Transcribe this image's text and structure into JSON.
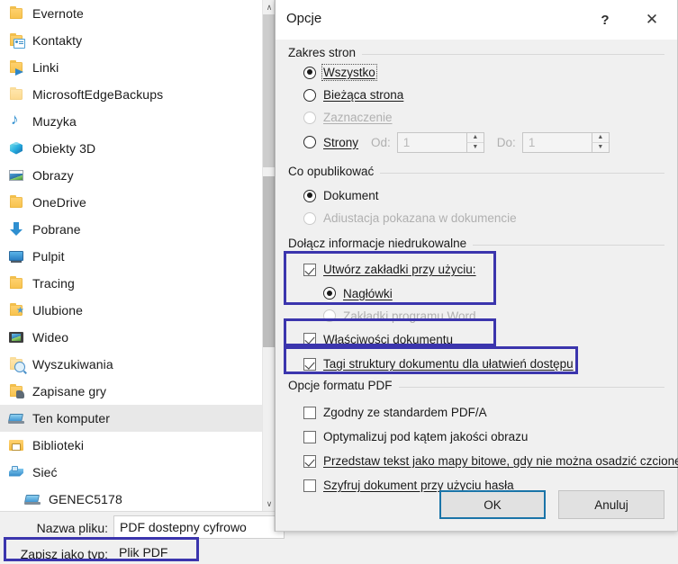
{
  "file_tree": {
    "items": [
      {
        "label": "Evernote",
        "icon": "folder-icon",
        "indent": 1,
        "selected": false
      },
      {
        "label": "Kontakty",
        "icon": "contacts-folder-icon",
        "indent": 1,
        "selected": false
      },
      {
        "label": "Linki",
        "icon": "links-folder-icon",
        "indent": 1,
        "selected": false
      },
      {
        "label": "MicrosoftEdgeBackups",
        "icon": "folder-icon",
        "indent": 1,
        "selected": false
      },
      {
        "label": "Muzyka",
        "icon": "music-note-icon",
        "indent": 1,
        "selected": false
      },
      {
        "label": "Obiekty 3D",
        "icon": "3d-objects-icon",
        "indent": 1,
        "selected": false
      },
      {
        "label": "Obrazy",
        "icon": "pictures-icon",
        "indent": 1,
        "selected": false
      },
      {
        "label": "OneDrive",
        "icon": "folder-icon",
        "indent": 1,
        "selected": false
      },
      {
        "label": "Pobrane",
        "icon": "downloads-arrow-icon",
        "indent": 1,
        "selected": false
      },
      {
        "label": "Pulpit",
        "icon": "desktop-icon",
        "indent": 1,
        "selected": false
      },
      {
        "label": "Tracing",
        "icon": "folder-icon",
        "indent": 1,
        "selected": false
      },
      {
        "label": "Ulubione",
        "icon": "favorites-folder-icon",
        "indent": 1,
        "selected": false
      },
      {
        "label": "Wideo",
        "icon": "video-icon",
        "indent": 1,
        "selected": false
      },
      {
        "label": "Wyszukiwania",
        "icon": "search-folder-icon",
        "indent": 1,
        "selected": false
      },
      {
        "label": "Zapisane gry",
        "icon": "saved-games-folder-icon",
        "indent": 1,
        "selected": false
      },
      {
        "label": "Ten komputer",
        "icon": "this-pc-icon",
        "indent": 1,
        "selected": true
      },
      {
        "label": "Biblioteki",
        "icon": "libraries-icon",
        "indent": 1,
        "selected": false
      },
      {
        "label": "Sieć",
        "icon": "network-icon",
        "indent": 1,
        "selected": false
      },
      {
        "label": "GENEC5178",
        "icon": "computer-icon",
        "indent": 2,
        "selected": false
      }
    ],
    "scrollbar": {
      "up_arrow": "∧",
      "down_arrow": "∨"
    }
  },
  "bottom_bar": {
    "file_name_label": "Nazwa pliku:",
    "file_name_value": "PDF dostepny cyfrowo",
    "save_as_type_label": "Zapisz jako typ:",
    "save_as_type_value": "Plik PDF",
    "highlight_color": "#3b35ad"
  },
  "dialog": {
    "title": "Opcje",
    "help_icon": "?",
    "close_icon": "✕",
    "highlight_color": "#3b35ad",
    "groups": {
      "page_range": {
        "label": "Zakres stron",
        "options": [
          {
            "label": "Wszystko",
            "underline": "W",
            "selected": true,
            "disabled": false,
            "focused": true
          },
          {
            "label": "Bieżąca strona",
            "underline": "B",
            "selected": false,
            "disabled": false,
            "focused": false
          },
          {
            "label": "Zaznaczenie",
            "underline": "Z",
            "selected": false,
            "disabled": true,
            "focused": false
          },
          {
            "label": "Strony",
            "underline": "y",
            "selected": false,
            "disabled": false,
            "focused": false
          }
        ],
        "from_label": "Od:",
        "from_value": "1",
        "to_label": "Do:",
        "to_value": "1",
        "spin_up": "▲",
        "spin_down": "▼"
      },
      "publish_what": {
        "label": "Co opublikować",
        "options": [
          {
            "label": "Dokument",
            "underline": "m",
            "selected": true,
            "disabled": false
          },
          {
            "label": "Adiustacja pokazana w dokumencie",
            "underline": "",
            "selected": false,
            "disabled": true
          }
        ]
      },
      "include_nonprinting": {
        "label": "Dołącz informacje niedrukowalne",
        "checkboxes": [
          {
            "label": "Utwórz zakładki przy użyciu:",
            "underline": "U",
            "checked": true,
            "disabled": false,
            "highlighted": true
          },
          {
            "label": "Właściwości dokumentu",
            "underline": "a",
            "checked": true,
            "disabled": false,
            "highlighted": true
          },
          {
            "label": "Tagi struktury dokumentu dla ułatwień dostępu",
            "underline": "T",
            "checked": true,
            "disabled": false,
            "highlighted": true
          }
        ],
        "bookmark_options": [
          {
            "label": "Nagłówki",
            "underline": "N",
            "selected": true,
            "disabled": false
          },
          {
            "label": "Zakładki programu Word",
            "underline": "",
            "selected": false,
            "disabled": true
          }
        ]
      },
      "pdf_format": {
        "label": "Opcje formatu PDF",
        "checkboxes": [
          {
            "label": "Zgodny ze standardem PDF/A",
            "underline": "/",
            "checked": false,
            "disabled": false
          },
          {
            "label": "Optymalizuj pod kątem jakości obrazu",
            "underline": "",
            "checked": false,
            "disabled": false
          },
          {
            "label": "Przedstaw tekst jako mapy bitowe, gdy nie można osadzić czcionek",
            "underline": "P",
            "checked": true,
            "disabled": false
          },
          {
            "label": "Szyfruj dokument przy użyciu hasła",
            "underline": "S",
            "checked": false,
            "disabled": false
          }
        ]
      }
    },
    "buttons": {
      "ok": "OK",
      "cancel": "Anuluj"
    }
  }
}
